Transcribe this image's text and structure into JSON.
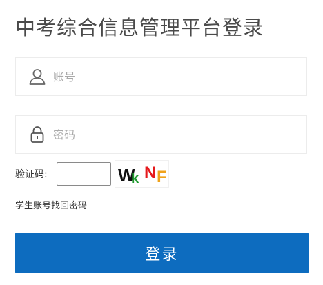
{
  "page": {
    "title": "中考综合信息管理平台登录"
  },
  "login_form": {
    "username": {
      "icon": "user-icon",
      "placeholder": "账号",
      "value": ""
    },
    "password": {
      "icon": "lock-icon",
      "placeholder": "密码",
      "value": ""
    },
    "captcha": {
      "label": "验证码:",
      "value": "",
      "image_text": [
        "W",
        "k",
        "N",
        "F"
      ],
      "image_colors": [
        "#111111",
        "#1e9a2e",
        "#e5191c",
        "#f0a21a"
      ]
    },
    "forgot_link": "学生账号找回密码",
    "submit_label": "登录"
  },
  "colors": {
    "primary": "#0d6cbf",
    "title_text": "#4a4a4a",
    "field_border": "#ececec",
    "placeholder": "#a9a9a9"
  }
}
